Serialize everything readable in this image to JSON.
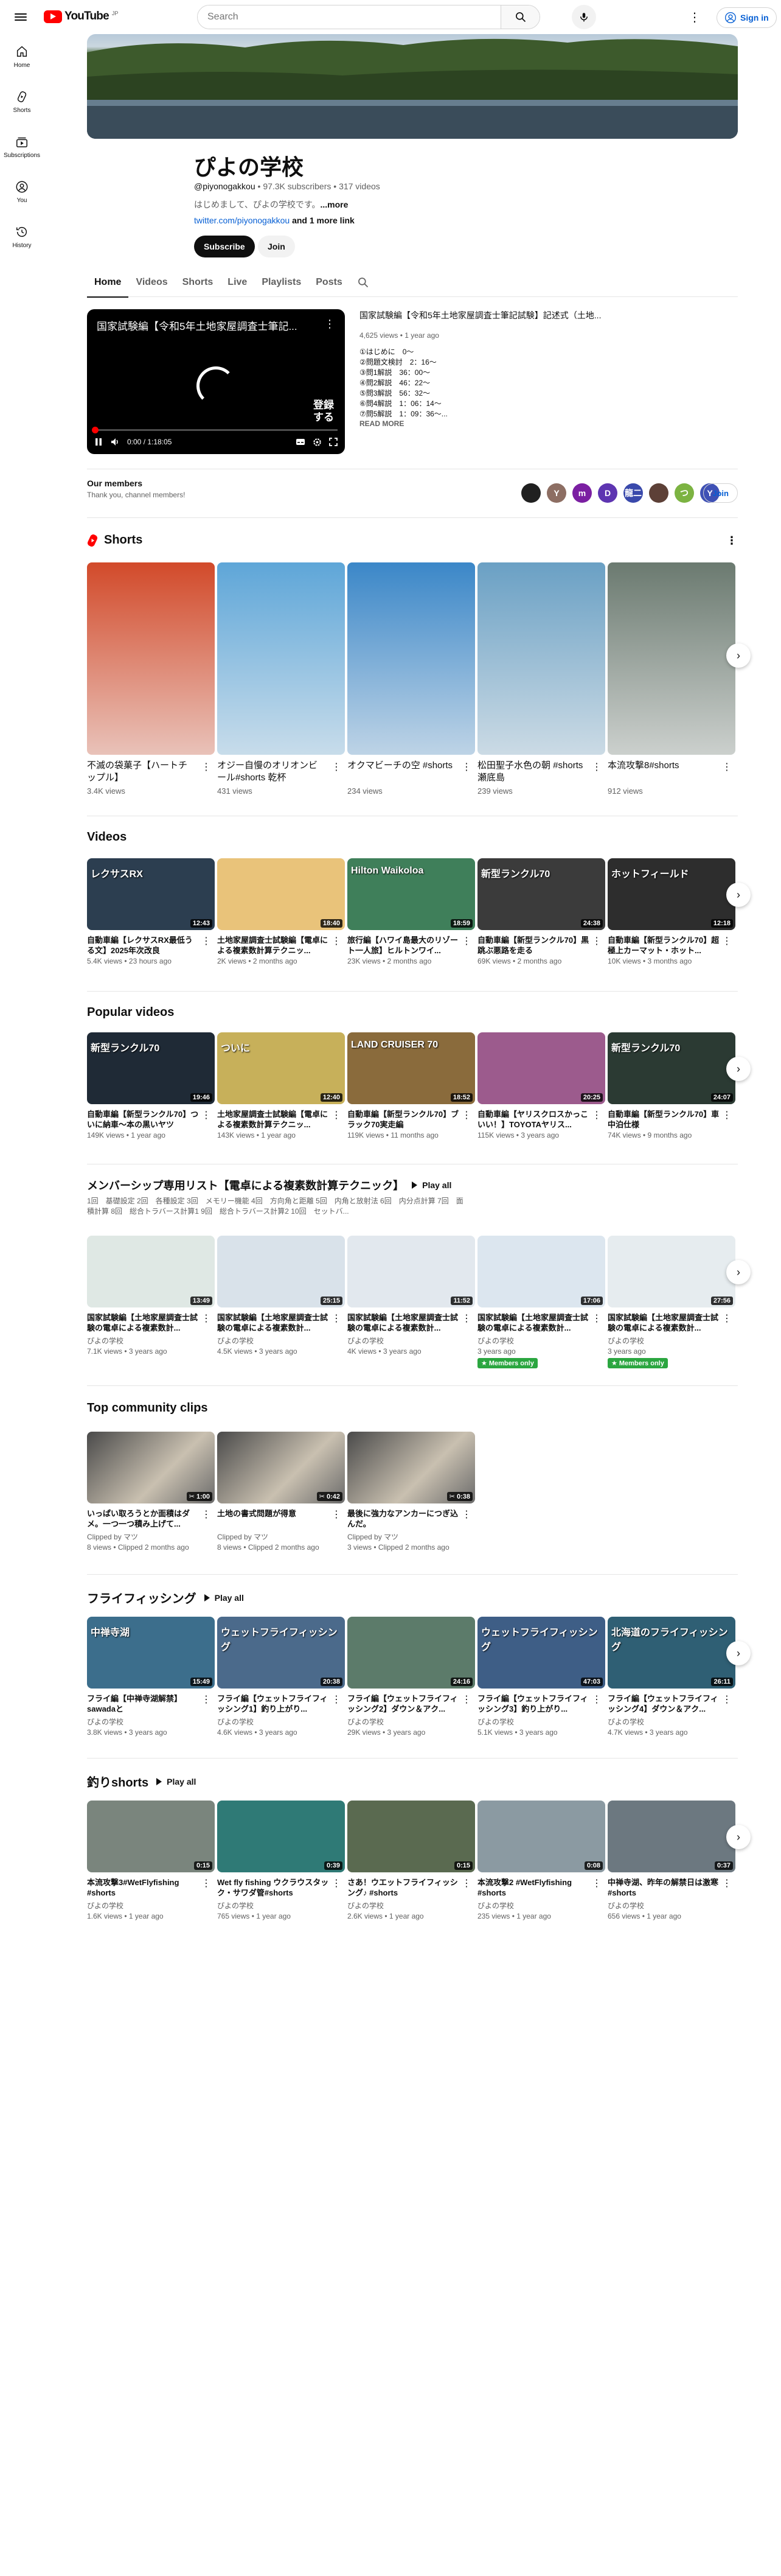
{
  "app": {
    "logo_text": "YouTube",
    "logo_region": "JP"
  },
  "search": {
    "placeholder": "Search"
  },
  "header": {
    "signin_label": "Sign in"
  },
  "sidebar": {
    "items": [
      {
        "label": "Home",
        "icon": "home-icon"
      },
      {
        "label": "Shorts",
        "icon": "shorts-icon"
      },
      {
        "label": "Subscriptions",
        "icon": "subscriptions-icon"
      },
      {
        "label": "You",
        "icon": "you-icon"
      },
      {
        "label": "History",
        "icon": "history-icon"
      }
    ]
  },
  "channel": {
    "name": "ぴよの学校",
    "handle": "@piyonogakkou",
    "subscribers": "97.3K subscribers",
    "videos": "317 videos",
    "description": "はじめまして、ぴよの学校です。",
    "more": "...more",
    "link": "twitter.com/piyonogakkou",
    "link_more": "and 1 more link",
    "subscribe_label": "Subscribe",
    "join_label": "Join"
  },
  "tabs": [
    {
      "label": "Home"
    },
    {
      "label": "Videos"
    },
    {
      "label": "Shorts"
    },
    {
      "label": "Live"
    },
    {
      "label": "Playlists"
    },
    {
      "label": "Posts"
    }
  ],
  "featured": {
    "player_title": "国家試験編【令和5年土地家屋調査士筆記...",
    "overlay_text": "登録\nする",
    "time": "0:00 / 1:18:05",
    "title": "国家試験編【令和5年土地家屋調査士筆記試験】記述式（土地...",
    "meta": "4,625 views • 1 year ago",
    "description": "①はじめに　0〜\n②問題文検討　2：16〜\n③問1解説　36：00〜\n④問2解説　46：22〜\n⑤問3解説　56：32〜\n⑥問4解説　1：06：14〜\n⑦問5解説　1：09：36〜...",
    "read_more": "READ MORE"
  },
  "members": {
    "title": "Our members",
    "subtitle": "Thank you, channel members!",
    "join_label": "Join",
    "avatars": [
      {
        "letter": "",
        "color": "#202020"
      },
      {
        "letter": "Y",
        "color": "#8d6e63"
      },
      {
        "letter": "m",
        "color": "#7b1fa2"
      },
      {
        "letter": "D",
        "color": "#5e35b1"
      },
      {
        "letter": "龍二",
        "color": "#3949ab"
      },
      {
        "letter": "",
        "color": "#5d4037"
      },
      {
        "letter": "つ",
        "color": "#7cb342"
      },
      {
        "letter": "Y",
        "color": "#3f51b5"
      }
    ]
  },
  "shorts": {
    "title": "Shorts",
    "items": [
      {
        "title": "不滅の袋菓子【ハートチップル】",
        "views": "3.4K views",
        "bg": "#d24a2a"
      },
      {
        "title": "オジー自慢のオリオンビール#shorts 乾杯",
        "views": "431 views",
        "bg": "#5ea6d8"
      },
      {
        "title": "オクマビーチの空 #shorts",
        "views": "234 views",
        "bg": "#3b87c8"
      },
      {
        "title": "松田聖子水色の朝 #shorts瀬底島",
        "views": "239 views",
        "bg": "#6aa0c4"
      },
      {
        "title": "本流攻撃8#shorts",
        "views": "912 views",
        "bg": "#6b7a70"
      }
    ]
  },
  "videos": {
    "title": "Videos",
    "items": [
      {
        "title": "自動車編【レクサスRX最低うる文】2025年次改良",
        "meta": "5.4K views • 23 hours ago",
        "dur": "12:43",
        "bg": "#2c3e50",
        "label": "レクサスRX"
      },
      {
        "title": "土地家屋調査士試験編【電卓による複素数計算テクニッ...",
        "meta": "2K views • 2 months ago",
        "dur": "18:40",
        "bg": "#e9c37a",
        "label": ""
      },
      {
        "title": "旅行編【ハワイ島最大のリゾート一人旅】ヒルトンワイ...",
        "meta": "23K views • 2 months ago",
        "dur": "18:59",
        "bg": "#3f7f5a",
        "label": "Hilton Waikoloa"
      },
      {
        "title": "自動車編【新型ランクル70】黒跳ぶ悪路を走る",
        "meta": "69K views • 2 months ago",
        "dur": "24:38",
        "bg": "#3b3b3b",
        "label": "新型ランクル70"
      },
      {
        "title": "自動車編【新型ランクル70】超極上カーマット・ホット...",
        "meta": "10K views • 3 months ago",
        "dur": "12:18",
        "bg": "#2d2d2d",
        "label": "ホットフィールド"
      }
    ]
  },
  "popular": {
    "title": "Popular videos",
    "items": [
      {
        "title": "自動車編【新型ランクル70】ついに納車〜本の黒いヤツ",
        "meta": "149K views • 1 year ago",
        "dur": "19:46",
        "bg": "#1f2a36",
        "label": "新型ランクル70"
      },
      {
        "title": "土地家屋調査士試験編【電卓による複素数計算テクニッ...",
        "meta": "143K views • 1 year ago",
        "dur": "12:40",
        "bg": "#c7b05a",
        "label": "ついに"
      },
      {
        "title": "自動車編【新型ランクル70】ブラック70実走編",
        "meta": "119K views • 11 months ago",
        "dur": "18:52",
        "bg": "#8a6b3c",
        "label": "LAND CRUISER 70"
      },
      {
        "title": "自動車編【ヤリスクロスかっこいい！】TOYOTAヤリス...",
        "meta": "115K views • 3 years ago",
        "dur": "20:25",
        "bg": "#9c5b8d",
        "label": ""
      },
      {
        "title": "自動車編【新型ランクル70】車中泊仕様",
        "meta": "74K views • 9 months ago",
        "dur": "24:07",
        "bg": "#2b3a33",
        "label": "新型ランクル70"
      }
    ]
  },
  "membership": {
    "title": "メンバーシップ専用リスト【電卓による複素数計算テクニック】",
    "play_all": "Play all",
    "description": "1回　基礎設定 2回　各種設定 3回　メモリー機能 4回　方向角と距離 5回　内角と放射法 6回　内分点計算 7回　面積計算 8回　総合トラバース計算1 9回　総合トラバース計算2 10回　セットバ...",
    "items": [
      {
        "title": "国家試験編【土地家屋調査士試験の電卓による複素数計...",
        "channel": "ぴよの学校",
        "meta": "7.1K views • 3 years ago",
        "dur": "13:49",
        "bg": "#dfe8e4",
        "badge": ""
      },
      {
        "title": "国家試験編【土地家屋調査士試験の電卓による複素数計...",
        "channel": "ぴよの学校",
        "meta": "4.5K views • 3 years ago",
        "dur": "25:15",
        "bg": "#d9e2ea",
        "badge": ""
      },
      {
        "title": "国家試験編【土地家屋調査士試験の電卓による複素数計...",
        "channel": "ぴよの学校",
        "meta": "4K views • 3 years ago",
        "dur": "11:52",
        "bg": "#e2e8ee",
        "badge": ""
      },
      {
        "title": "国家試験編【土地家屋調査士試験の電卓による複素数計...",
        "channel": "ぴよの学校",
        "meta": "3 years ago",
        "dur": "17:06",
        "bg": "#dce6ef",
        "badge": "Members only"
      },
      {
        "title": "国家試験編【土地家屋調査士試験の電卓による複素数計...",
        "channel": "ぴよの学校",
        "meta": "3 years ago",
        "dur": "27:56",
        "bg": "#e6ecef",
        "badge": "Members only"
      }
    ]
  },
  "clips": {
    "title": "Top community clips",
    "items": [
      {
        "title": "いっぱい取ろうとか面積はダメ。一つ一つ積み上げて...",
        "clipped": "Clipped by マツ",
        "meta": "8 views • Clipped 2 months ago",
        "dur": "1:00"
      },
      {
        "title": "土地の書式問題が得意",
        "clipped": "Clipped by マツ",
        "meta": "8 views • Clipped 2 months ago",
        "dur": "0:42"
      },
      {
        "title": "最後に強力なアンカーにつぎ込んだ。",
        "clipped": "Clipped by マツ",
        "meta": "3 views • Clipped 2 months ago",
        "dur": "0:38"
      }
    ]
  },
  "fly": {
    "title": "フライフィッシング",
    "play_all": "Play all",
    "items": [
      {
        "title": "フライ編【中禅寺湖解禁】sawadaと",
        "channel": "ぴよの学校",
        "meta": "3.8K views • 3 years ago",
        "dur": "15:49",
        "bg": "#3c6e8c",
        "label": "中禅寺湖"
      },
      {
        "title": "フライ編【ウェットフライフィッシング1】釣り上がり...",
        "channel": "ぴよの学校",
        "meta": "4.6K views • 3 years ago",
        "dur": "20:38",
        "bg": "#4b6a8b",
        "label": "ウェットフライフィッシング"
      },
      {
        "title": "フライ編【ウェットフライフィッシング2】ダウン＆アク...",
        "channel": "ぴよの学校",
        "meta": "29K views • 3 years ago",
        "dur": "24:16",
        "bg": "#5c7b6a",
        "label": ""
      },
      {
        "title": "フライ編【ウェットフライフィッシング3】釣り上がり...",
        "channel": "ぴよの学校",
        "meta": "5.1K views • 3 years ago",
        "dur": "47:03",
        "bg": "#3e5e86",
        "label": "ウェットフライフィッシング"
      },
      {
        "title": "フライ編【ウェットフライフィッシング4】ダウン＆アク...",
        "channel": "ぴよの学校",
        "meta": "4.7K views • 3 years ago",
        "dur": "26:11",
        "bg": "#2f5f74",
        "label": "北海道のフライフィッシング"
      }
    ]
  },
  "tsuri": {
    "title": "釣りshorts",
    "play_all": "Play all",
    "items": [
      {
        "title": "本流攻撃3#WetFlyfishing #shorts",
        "channel": "ぴよの学校",
        "meta": "1.6K views • 1 year ago",
        "dur": "0:15",
        "bg": "#7a857d"
      },
      {
        "title": "Wet fly fishing ウクラウスタック・サワダ管#shorts",
        "channel": "ぴよの学校",
        "meta": "765 views • 1 year ago",
        "dur": "0:39",
        "bg": "#2f7a76"
      },
      {
        "title": "さあ！ウエットフライフィッシング♪ #shorts",
        "channel": "ぴよの学校",
        "meta": "2.6K views • 1 year ago",
        "dur": "0:15",
        "bg": "#5a6a50"
      },
      {
        "title": "本流攻撃2 #WetFlyfishing #shorts",
        "channel": "ぴよの学校",
        "meta": "235 views • 1 year ago",
        "dur": "0:08",
        "bg": "#8b9aa2"
      },
      {
        "title": "中禅寺湖、昨年の解禁日は激寒#shorts",
        "channel": "ぴよの学校",
        "meta": "656 views • 1 year ago",
        "dur": "0:37",
        "bg": "#6c7880"
      }
    ]
  }
}
